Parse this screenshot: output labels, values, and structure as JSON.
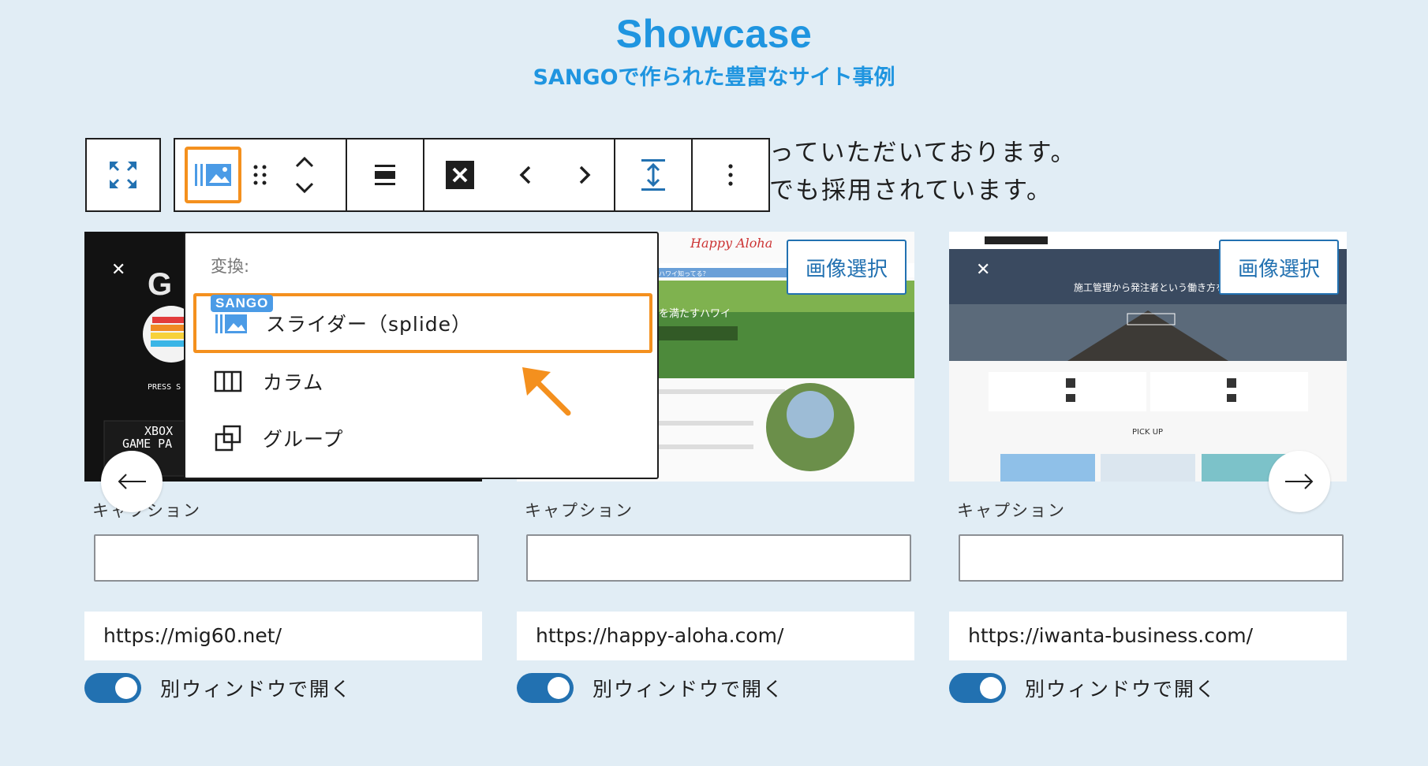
{
  "header": {
    "title": "Showcase",
    "subtitle": "SANGOで作られた豊富なサイト事例"
  },
  "paragraph": {
    "line1": "っていただいております。",
    "line2": "でも採用されています。"
  },
  "toolbar": {
    "icons": [
      "fullscreen-icon",
      "slider-block-icon",
      "drag-handle-icon",
      "move-up-icon",
      "move-down-icon",
      "align-icon",
      "remove-icon",
      "previous-icon",
      "next-icon",
      "height-icon",
      "more-options-icon"
    ]
  },
  "cards": [
    {
      "caption_label": "キャプション",
      "url": "https://mig60.net/",
      "toggle_label": "別ウィンドウで開く",
      "thumb_text": [
        "XBOX",
        "GAME PA",
        "PRESS S"
      ]
    },
    {
      "image_select_label": "画像選択",
      "caption_label": "キャプション",
      "url": "https://happy-aloha.com/",
      "toggle_label": "別ウィンドウで開く",
      "thumb_text": [
        "Happy Aloha",
        "ハワイ知ってる？",
        "知的好奇心を満たすハワイ"
      ]
    },
    {
      "image_select_label": "画像選択",
      "caption_label": "キャプション",
      "url": "https://iwanta-business.com/",
      "toggle_label": "別ウィンドウで開く",
      "thumb_text": [
        "施工管理から発注者という働き方を",
        "PICK UP"
      ]
    }
  ],
  "dropdown": {
    "title": "変換:",
    "items": [
      {
        "label": "スライダー（splide）",
        "badge": "SANGO",
        "icon": "slider-icon",
        "highlighted": true
      },
      {
        "label": "カラム",
        "icon": "columns-icon",
        "highlighted": false
      },
      {
        "label": "グループ",
        "icon": "group-icon",
        "highlighted": false
      }
    ]
  },
  "nav": {
    "prev_icon": "arrow-left-icon",
    "next_icon": "arrow-right-icon"
  },
  "colors": {
    "background": "#e1edf5",
    "brand_blue": "#1f95e0",
    "highlight_orange": "#f4901e",
    "toggle_blue": "#2271b1"
  }
}
